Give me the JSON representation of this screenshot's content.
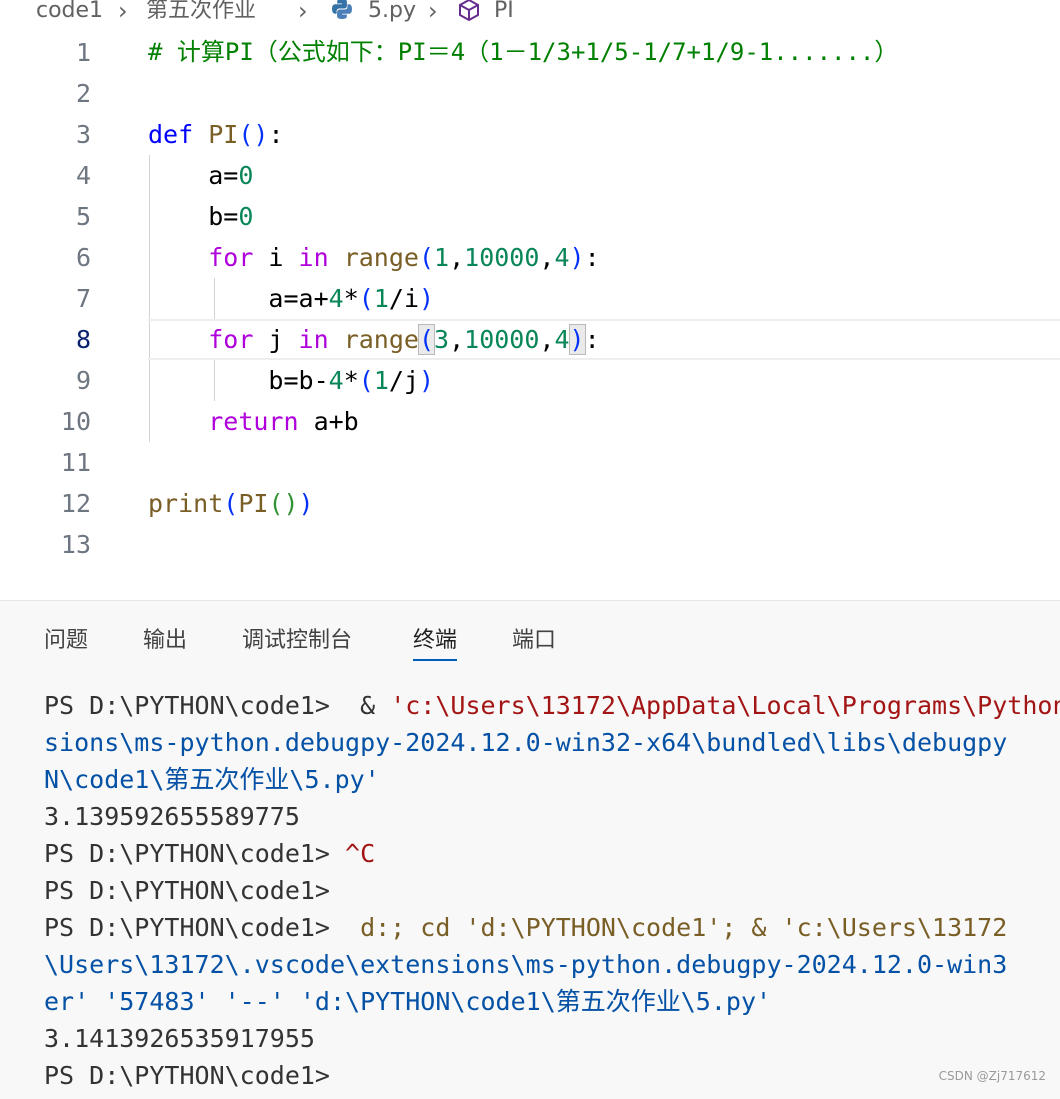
{
  "breadcrumb": {
    "root": "code1",
    "folder": "第五次作业",
    "file": "5.py",
    "symbol": "PI"
  },
  "editor": {
    "line_numbers": [
      "1",
      "2",
      "3",
      "4",
      "5",
      "6",
      "7",
      "8",
      "9",
      "10",
      "11",
      "12",
      "13"
    ],
    "comment": "# 计算PI（公式如下：PI＝4（1－1/3+1/5-1/7+1/9-1.......）",
    "lines": {
      "def_kw": "def",
      "def_name": "PI",
      "a0": "a=",
      "b0": "b=",
      "zero": "0",
      "for_kw": "for",
      "in_kw": "in",
      "range_fn": "range",
      "var_i": " i ",
      "var_j": " j ",
      "range1_a": "1",
      "range2_a": "3",
      "range_b": "10000",
      "range_c": "4",
      "body1": "a=a+",
      "body2": "b=b-",
      "four": "4",
      "mul": "*",
      "one": "1",
      "div_i": "/i",
      "div_j": "/j",
      "return_kw": "return",
      "return_expr": " a+b",
      "print_fn": "print",
      "print_arg": "PI"
    }
  },
  "panel": {
    "tabs": [
      "问题",
      "输出",
      "调试控制台",
      "终端",
      "端口"
    ],
    "active_tab": "终端"
  },
  "terminal": {
    "lines": [
      [
        "PS D:\\PYTHON\\code1>  & ",
        "'c:\\Users\\13172\\AppData\\Local\\Programs\\Python"
      ],
      [
        "",
        "sions\\ms-python.debugpy-2024.12.0-win32-x64\\bundled\\libs\\debugpy"
      ],
      [
        "",
        "N\\code1\\第五次作业\\5.py'"
      ],
      [
        "3.139592655589775",
        ""
      ],
      [
        "PS D:\\PYTHON\\code1> ",
        "^C"
      ],
      [
        "PS D:\\PYTHON\\code1>",
        ""
      ],
      [
        "PS D:\\PYTHON\\code1>  ",
        "d:; cd 'd:\\PYTHON\\code1'; & 'c:\\Users\\13172"
      ],
      [
        "",
        "\\Users\\13172\\.vscode\\extensions\\ms-python.debugpy-2024.12.0-win3"
      ],
      [
        "",
        "er' '57483' '--' 'd:\\PYTHON\\code1\\第五次作业\\5.py'"
      ],
      [
        "3.1413926535917955",
        ""
      ],
      [
        "PS D:\\PYTHON\\code1>",
        ""
      ]
    ]
  },
  "watermark": "CSDN @Zj717612",
  "colors": {
    "keyword": "#af00db",
    "def_keyword": "#0000ff",
    "function": "#795e26",
    "number": "#098658",
    "comment": "#008000",
    "active_tab_underline": "#005fb8"
  }
}
